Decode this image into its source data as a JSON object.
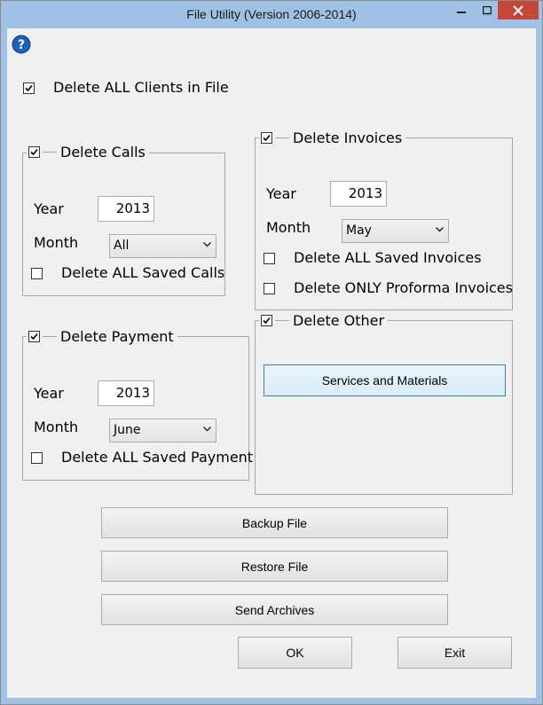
{
  "window": {
    "title": "File Utility (Version 2006-2014)"
  },
  "help_icon": "question-mark-icon",
  "delete_all_clients": {
    "label": "Delete ALL Clients in File",
    "checked": true
  },
  "calls": {
    "label": "Delete Calls",
    "checked": true,
    "year_label": "Year",
    "year_value": "2013",
    "month_label": "Month",
    "month_value": "All",
    "saved_label": "Delete ALL Saved Calls",
    "saved_checked": false
  },
  "invoices": {
    "label": "Delete Invoices",
    "checked": true,
    "year_label": "Year",
    "year_value": "2013",
    "month_label": "Month",
    "month_value": "May",
    "saved_label": "Delete ALL Saved Invoices",
    "saved_checked": false,
    "proforma_label": "Delete ONLY Proforma Invoices",
    "proforma_checked": false
  },
  "payment": {
    "label": "Delete Payment",
    "checked": true,
    "year_label": "Year",
    "year_value": "2013",
    "month_label": "Month",
    "month_value": "June",
    "saved_label": "Delete ALL Saved Payment",
    "saved_checked": false
  },
  "other": {
    "label": "Delete Other",
    "checked": true,
    "services_button": "Services and Materials"
  },
  "buttons": {
    "backup": "Backup File",
    "restore": "Restore File",
    "send": "Send Archives",
    "ok": "OK",
    "exit": "Exit"
  },
  "colors": {
    "title_bar": "#9fc1e4",
    "close_button": "#c7463a",
    "client_area": "#f0f0f0",
    "help_icon": "#1f5fb5"
  }
}
